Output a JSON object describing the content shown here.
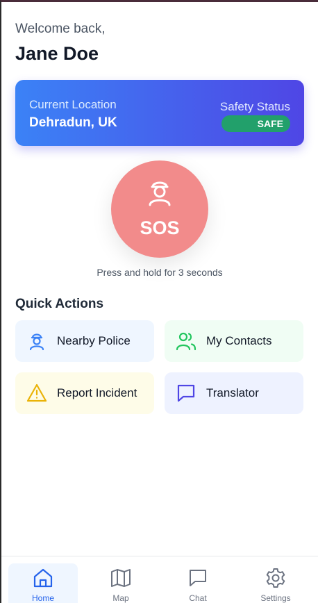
{
  "header": {
    "greeting": "Welcome back,",
    "user_name": "Jane Doe"
  },
  "location_card": {
    "location_label": "Current Location",
    "location_value": "Dehradun, UK",
    "safety_label": "Safety Status",
    "safety_status": "SAFE"
  },
  "sos": {
    "label": "SOS",
    "hint": "Press and hold for 3 seconds",
    "icon": "police-officer-icon"
  },
  "quick_actions": {
    "title": "Quick Actions",
    "items": [
      {
        "label": "Nearby Police",
        "icon": "police-officer-icon",
        "bg": "#eff6ff",
        "icon_color": "#3b82f6"
      },
      {
        "label": "My Contacts",
        "icon": "users-icon",
        "bg": "#f0fdf4",
        "icon_color": "#22c55e"
      },
      {
        "label": "Report Incident",
        "icon": "warning-triangle-icon",
        "bg": "#fefce8",
        "icon_color": "#eab308"
      },
      {
        "label": "Translator",
        "icon": "chat-bubble-icon",
        "bg": "#eef2ff",
        "icon_color": "#4f46e5"
      }
    ]
  },
  "nav": {
    "items": [
      {
        "label": "Home",
        "icon": "home-icon",
        "active": true
      },
      {
        "label": "Map",
        "icon": "map-icon",
        "active": false
      },
      {
        "label": "Chat",
        "icon": "chat-icon",
        "active": false
      },
      {
        "label": "Settings",
        "icon": "gear-icon",
        "active": false
      }
    ]
  },
  "colors": {
    "brand_gradient_start": "#3b82f6",
    "brand_gradient_end": "#4f46e5",
    "safe_badge": "#22a06b",
    "sos_button": "#f28b8b",
    "nav_active": "#2563eb"
  }
}
